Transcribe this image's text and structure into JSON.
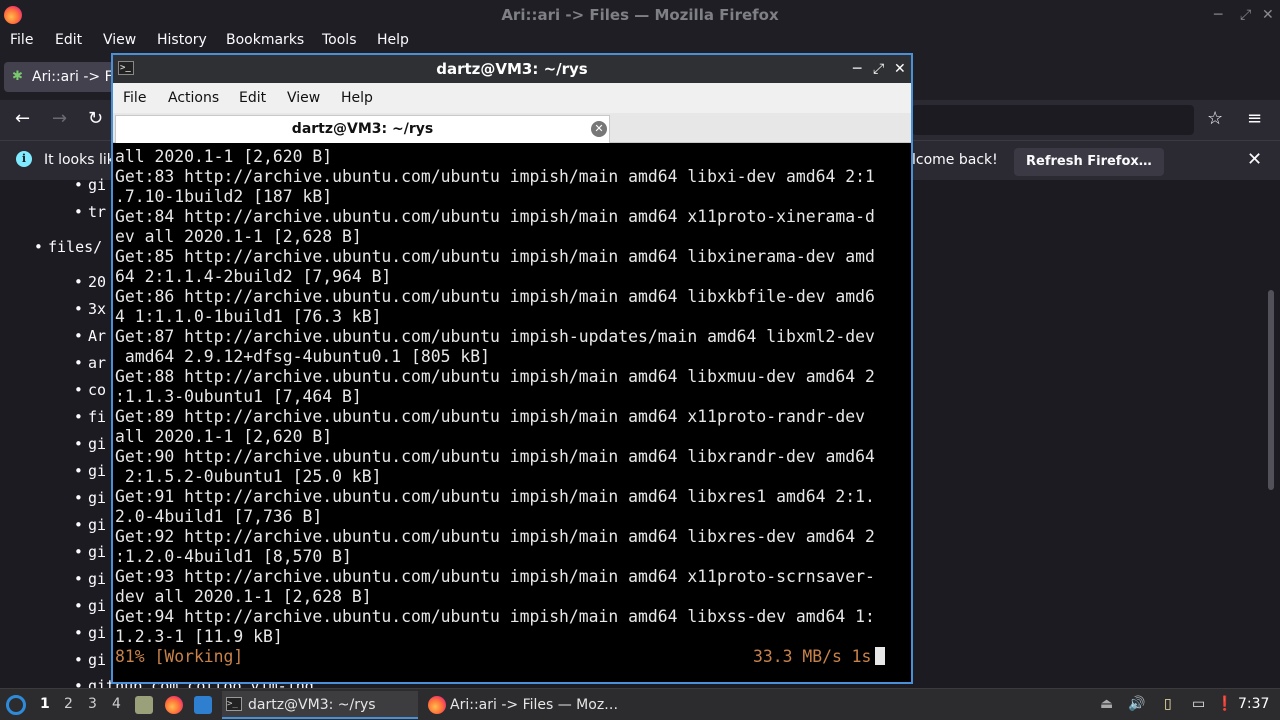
{
  "firefox": {
    "window_title": "Ari::ari -> Files — Mozilla Firefox",
    "menu": [
      "File",
      "Edit",
      "View",
      "History",
      "Bookmarks",
      "Tools",
      "Help"
    ],
    "tab_title": "Ari::ari -> Fi",
    "notification": {
      "text_left": "It looks lik",
      "text_right": "lcome back!",
      "button": "Refresh Firefox…"
    },
    "page_list": {
      "top_items": [
        "gi",
        "tr"
      ],
      "folder": "files/",
      "items": [
        "20",
        "3x",
        "Ar",
        "ar",
        "co",
        "fi",
        "gi",
        "gi",
        "gi",
        "gi",
        "gi",
        "gi",
        "gi",
        "gi",
        "gi"
      ],
      "bottom_item": "github.com cottoo vim-ing"
    }
  },
  "terminal": {
    "window_title": "dartz@VM3: ~/rys",
    "menu": [
      "File",
      "Actions",
      "Edit",
      "View",
      "Help"
    ],
    "tab_title": "dartz@VM3: ~/rys",
    "lines": [
      "all 2020.1-1 [2,620 B]",
      "Get:83 http://archive.ubuntu.com/ubuntu impish/main amd64 libxi-dev amd64 2:1",
      ".7.10-1build2 [187 kB]",
      "Get:84 http://archive.ubuntu.com/ubuntu impish/main amd64 x11proto-xinerama-d",
      "ev all 2020.1-1 [2,628 B]",
      "Get:85 http://archive.ubuntu.com/ubuntu impish/main amd64 libxinerama-dev amd",
      "64 2:1.1.4-2build2 [7,964 B]",
      "Get:86 http://archive.ubuntu.com/ubuntu impish/main amd64 libxkbfile-dev amd6",
      "4 1:1.1.0-1build1 [76.3 kB]",
      "Get:87 http://archive.ubuntu.com/ubuntu impish-updates/main amd64 libxml2-dev",
      " amd64 2.9.12+dfsg-4ubuntu0.1 [805 kB]",
      "Get:88 http://archive.ubuntu.com/ubuntu impish/main amd64 libxmuu-dev amd64 2",
      ":1.1.3-0ubuntu1 [7,464 B]",
      "Get:89 http://archive.ubuntu.com/ubuntu impish/main amd64 x11proto-randr-dev",
      "all 2020.1-1 [2,620 B]",
      "Get:90 http://archive.ubuntu.com/ubuntu impish/main amd64 libxrandr-dev amd64",
      " 2:1.5.2-0ubuntu1 [25.0 kB]",
      "Get:91 http://archive.ubuntu.com/ubuntu impish/main amd64 libxres1 amd64 2:1.",
      "2.0-4build1 [7,736 B]",
      "Get:92 http://archive.ubuntu.com/ubuntu impish/main amd64 libxres-dev amd64 2",
      ":1.2.0-4build1 [8,570 B]",
      "Get:93 http://archive.ubuntu.com/ubuntu impish/main amd64 x11proto-scrnsaver-",
      "dev all 2020.1-1 [2,628 B]",
      "Get:94 http://archive.ubuntu.com/ubuntu impish/main amd64 libxss-dev amd64 1:",
      "1.2.3-1 [11.9 kB]"
    ],
    "status_left": "81% [Working]",
    "status_right": "33.3 MB/s 1s"
  },
  "taskbar": {
    "workspaces": [
      "1",
      "2",
      "3",
      "4"
    ],
    "active_workspace": "1",
    "tasks": [
      {
        "label": "dartz@VM3: ~/rys",
        "icon": "terminal-icon"
      },
      {
        "label": "Ari::ari -> Files — Moz…",
        "icon": "firefox-icon"
      }
    ],
    "clock": "7:37"
  }
}
